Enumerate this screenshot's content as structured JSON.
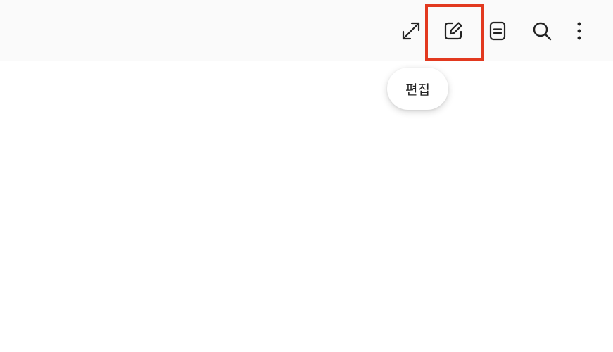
{
  "toolbar": {
    "buttons": [
      {
        "icon": "expand-arrows-icon",
        "label": ""
      },
      {
        "icon": "edit-icon",
        "label": ""
      },
      {
        "icon": "note-icon",
        "label": ""
      },
      {
        "icon": "search-icon",
        "label": ""
      },
      {
        "icon": "more-vertical-icon",
        "label": ""
      }
    ],
    "highlighted_button": "edit-icon",
    "highlight_color": "#e2391f"
  },
  "tooltip": {
    "text": "편집"
  }
}
